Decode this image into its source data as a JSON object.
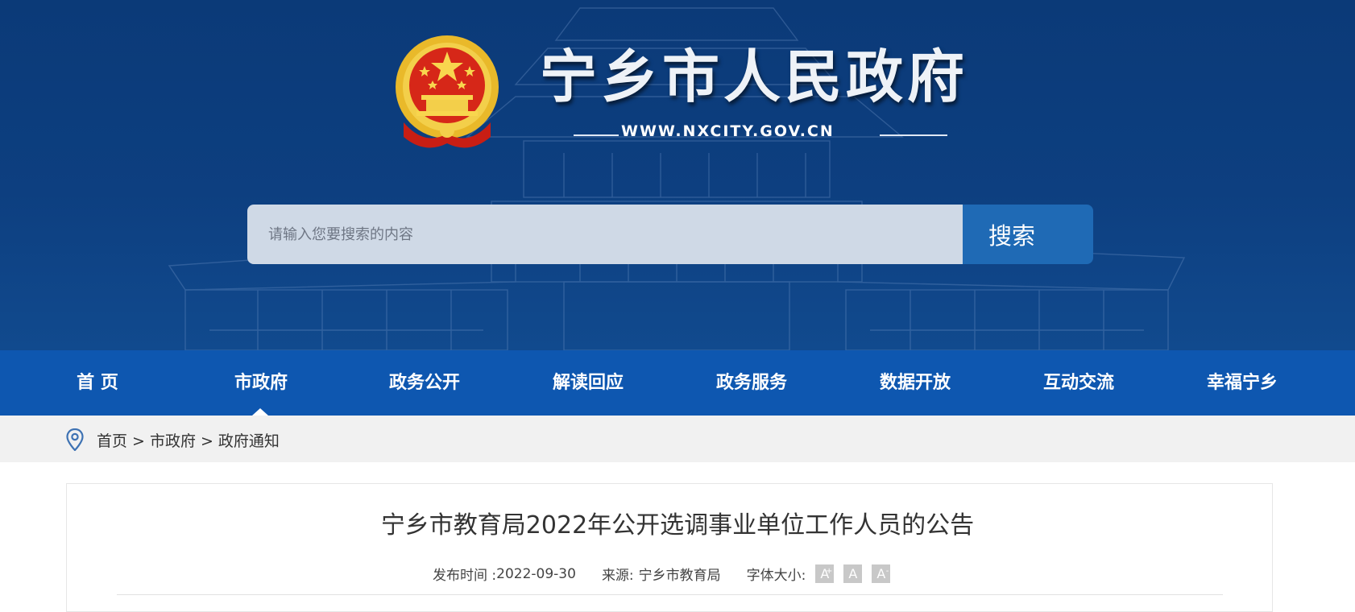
{
  "header": {
    "site_title": "宁乡市人民政府",
    "site_url": "WWW.NXCITY.GOV.CN",
    "emblem_icon": "national-emblem-icon"
  },
  "search": {
    "placeholder": "请输入您要搜索的内容",
    "button_label": "搜索"
  },
  "nav": {
    "items": [
      {
        "label": "首 页"
      },
      {
        "label": "市政府"
      },
      {
        "label": "政务公开"
      },
      {
        "label": "解读回应"
      },
      {
        "label": "政务服务"
      },
      {
        "label": "数据开放"
      },
      {
        "label": "互动交流"
      },
      {
        "label": "幸福宁乡"
      }
    ],
    "active": "市政府"
  },
  "breadcrumb": {
    "icon": "location-pin-icon",
    "items": [
      "首页",
      "市政府",
      "政府通知"
    ],
    "separator": ">"
  },
  "article": {
    "title": "宁乡市教育局2022年公开选调事业单位工作人员的公告",
    "publish_label": "发布时间 : ",
    "publish_date": "2022-09-30",
    "source_label": "来源:",
    "source": "宁乡市教育局",
    "font_size_label": "字体大小:",
    "font_buttons": [
      "A",
      "A",
      "A"
    ]
  },
  "colors": {
    "banner": "#0b3a78",
    "nav": "#0e57b0",
    "search_button": "#1f6ab5",
    "search_input": "#cfd9e6",
    "breadcrumb_bg": "#f1f1f1"
  }
}
